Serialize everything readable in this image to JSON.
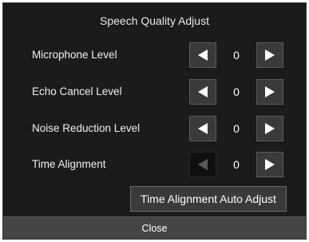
{
  "dialog": {
    "title": "Speech Quality Adjust",
    "rows": [
      {
        "label": "Microphone Level",
        "value": "0",
        "decrease_enabled": true,
        "increase_enabled": true
      },
      {
        "label": "Echo Cancel Level",
        "value": "0",
        "decrease_enabled": true,
        "increase_enabled": true
      },
      {
        "label": "Noise Reduction Level",
        "value": "0",
        "decrease_enabled": true,
        "increase_enabled": true
      },
      {
        "label": "Time Alignment",
        "value": "0",
        "decrease_enabled": false,
        "increase_enabled": true
      }
    ],
    "auto_adjust_label": "Time Alignment Auto Adjust",
    "close_label": "Close"
  },
  "icons": {
    "decrease": "triangle-left-icon",
    "increase": "triangle-right-icon"
  },
  "colors": {
    "background": "#1b1b1b",
    "button": "#3a3a3a",
    "button_disabled": "#101010",
    "close_bar": "#454545",
    "text": "#ffffff"
  }
}
